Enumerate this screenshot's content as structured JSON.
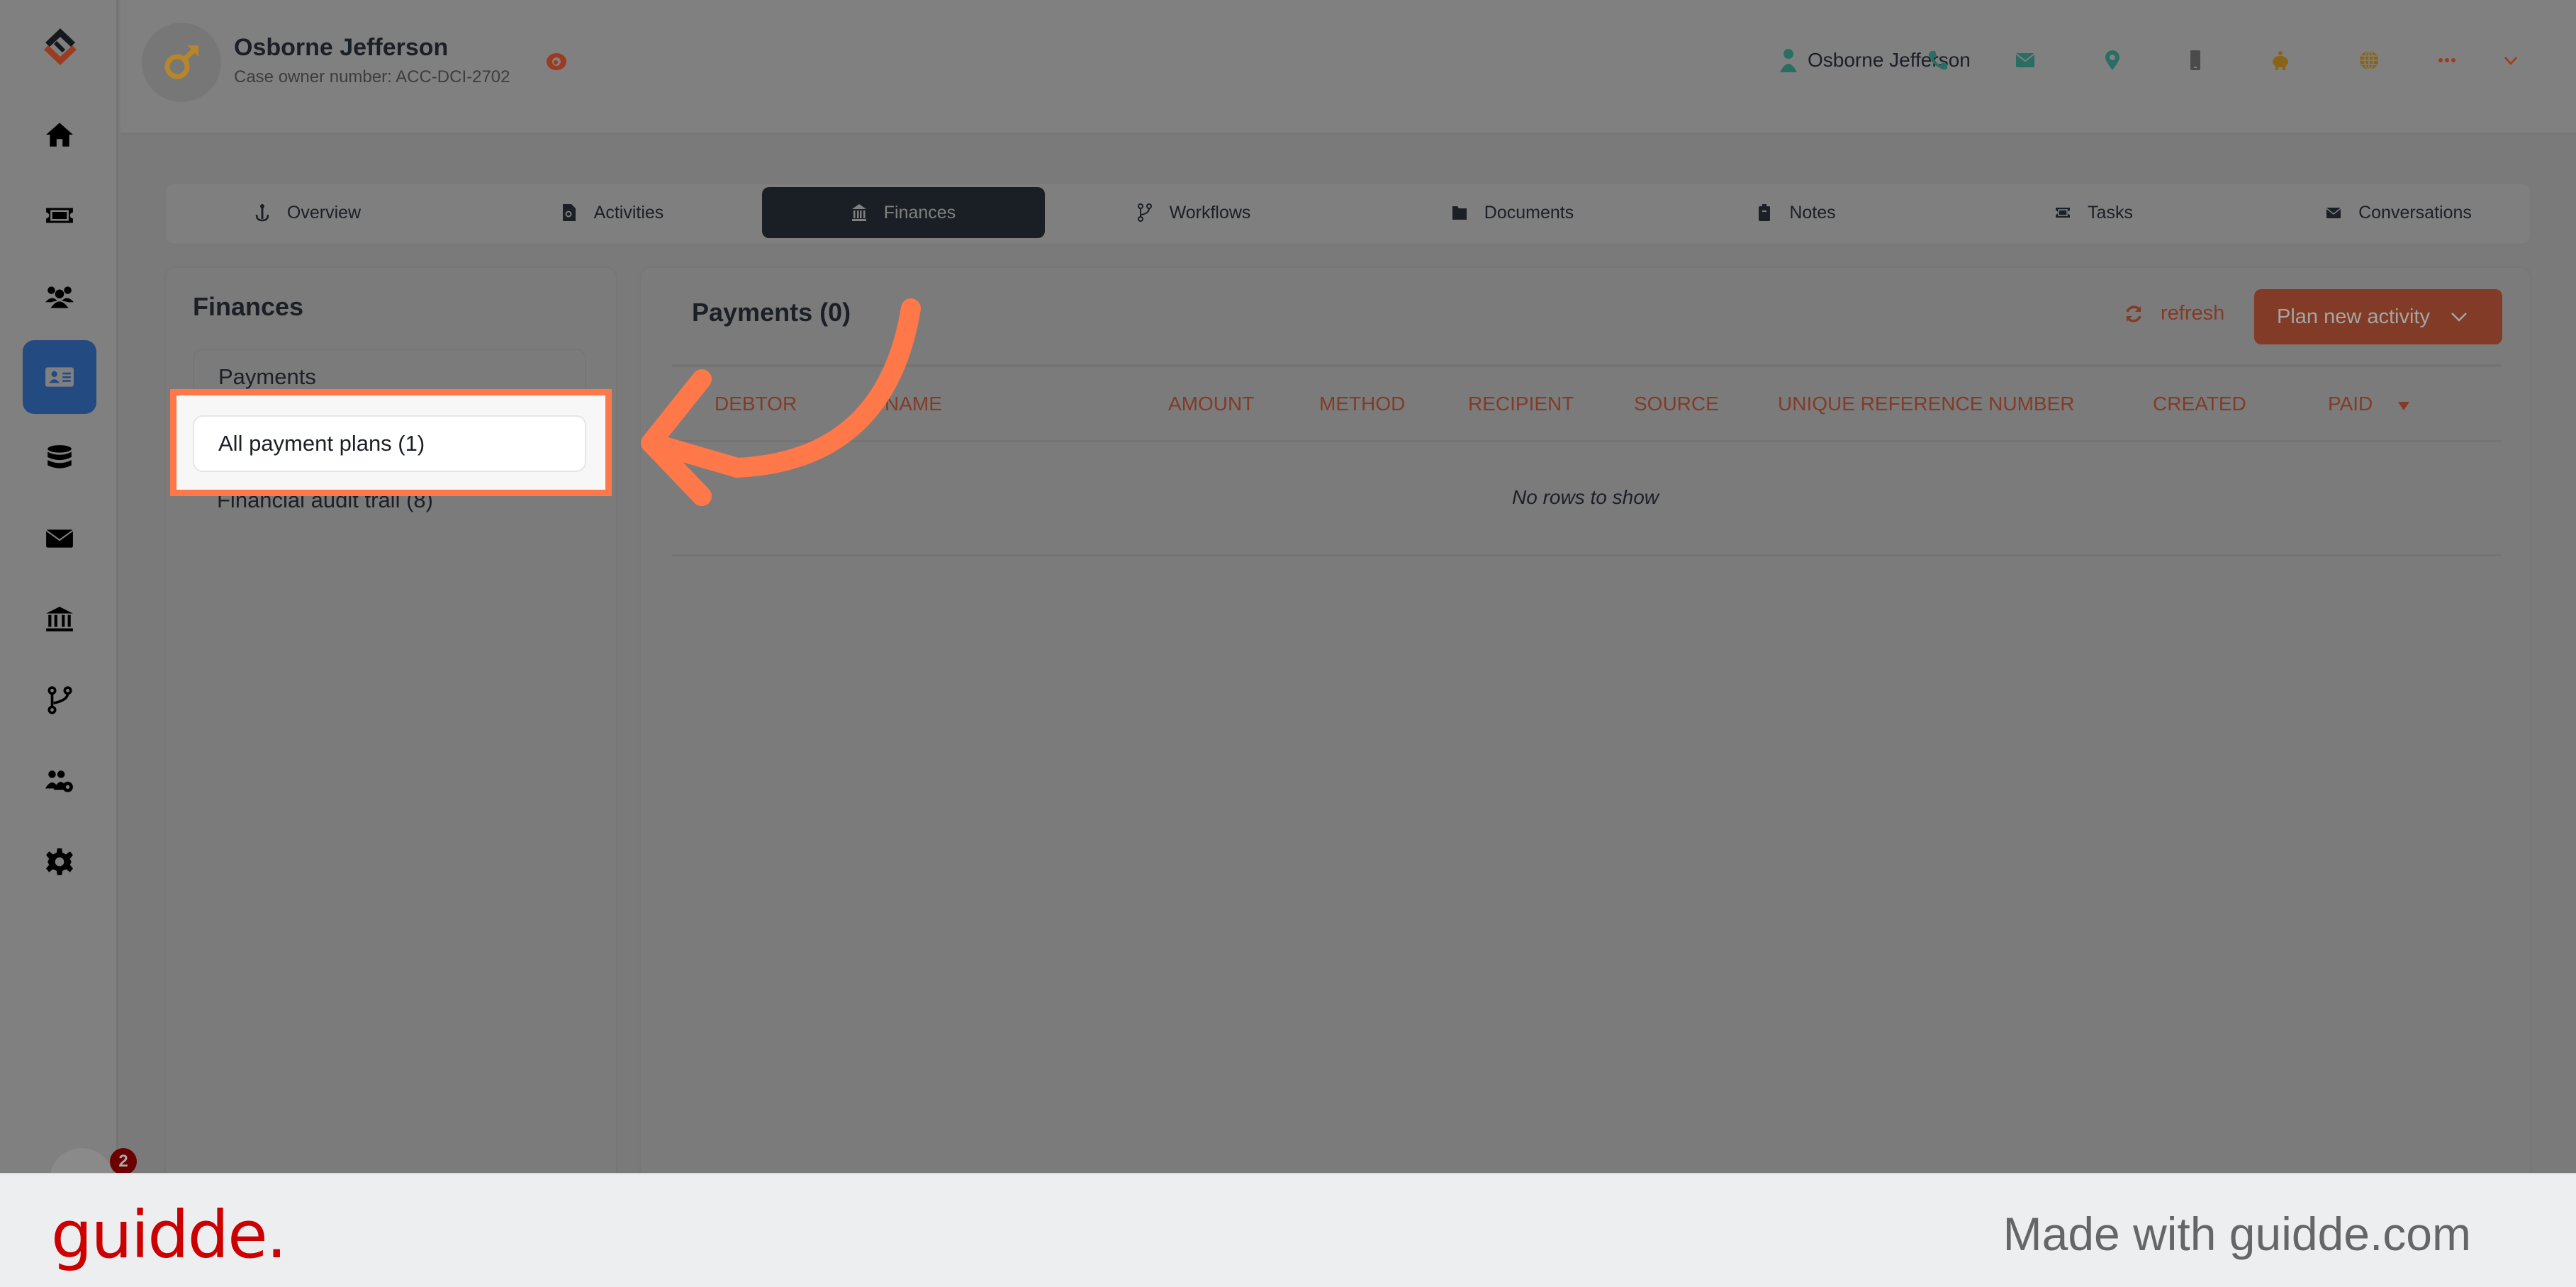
{
  "rail": {
    "items": [
      {
        "name": "home",
        "icon": "home-icon",
        "active": false
      },
      {
        "name": "tickets",
        "icon": "ticket-icon",
        "active": false
      },
      {
        "name": "people",
        "icon": "users-icon",
        "active": false
      },
      {
        "name": "cases",
        "icon": "id-card-icon",
        "active": true
      },
      {
        "name": "database",
        "icon": "database-icon",
        "active": false
      },
      {
        "name": "mail",
        "icon": "envelope-icon",
        "active": false
      },
      {
        "name": "finance",
        "icon": "bank-icon",
        "active": false
      },
      {
        "name": "workflows",
        "icon": "code-branch-icon",
        "active": false
      },
      {
        "name": "user-management",
        "icon": "users-gear-icon",
        "active": false
      },
      {
        "name": "settings",
        "icon": "gear-icon",
        "active": false
      }
    ],
    "notification_count": "2"
  },
  "header": {
    "case_name": "Osborne Jefferson",
    "case_subtitle": "Case owner number: ACC-DCI-2702",
    "user_name": "Osborne Jefferson",
    "icons": [
      "phone-icon",
      "envelope-icon",
      "map-marker-icon",
      "mobile-icon",
      "piggy-bank-icon",
      "globe-icon",
      "ellipsis-icon",
      "chevron-down-icon"
    ],
    "colors": {
      "teal": "#2a6e63",
      "gold": "#8a6416",
      "orange": "#823b26"
    }
  },
  "tabs": [
    {
      "label": "Overview",
      "icon": "anchor-icon",
      "active": false
    },
    {
      "label": "Activities",
      "icon": "file-search-icon",
      "active": false
    },
    {
      "label": "Finances",
      "icon": "bank-icon",
      "active": true
    },
    {
      "label": "Workflows",
      "icon": "code-branch-icon",
      "active": false
    },
    {
      "label": "Documents",
      "icon": "folder-icon",
      "active": false
    },
    {
      "label": "Notes",
      "icon": "clipboard-icon",
      "active": false
    },
    {
      "label": "Tasks",
      "icon": "ticket-icon",
      "active": false
    },
    {
      "label": "Conversations",
      "icon": "envelope-icon",
      "active": false
    }
  ],
  "finances_nav": {
    "title": "Finances",
    "items": [
      {
        "label": "Payments",
        "selected": false
      },
      {
        "label": "All payment plans (1)",
        "selected": true,
        "highlighted": true
      },
      {
        "label": "Financial audit trail (8)",
        "selected": false
      }
    ]
  },
  "payments": {
    "title": "Payments (0)",
    "refresh_label": "refresh",
    "plan_button_label": "Plan new activity",
    "columns": [
      "DEBTOR",
      "NAME",
      "AMOUNT",
      "METHOD",
      "RECIPIENT",
      "SOURCE",
      "UNIQUE REFERENCE NUMBER",
      "CREATED",
      "PAID"
    ],
    "sorted_column": "PAID",
    "sort_direction": "descending",
    "rows": [],
    "empty_message": "No rows to show"
  },
  "footer": {
    "logo": "guidde.",
    "made_with": "Made with guidde.com"
  }
}
